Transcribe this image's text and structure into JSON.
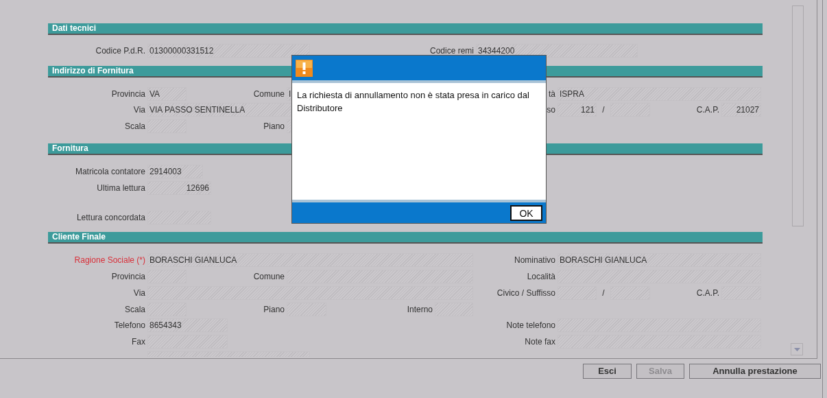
{
  "dati_tecnici": {
    "title": "Dati tecnici",
    "codice_pdr": {
      "label": "Codice P.d.R.",
      "value": "01300000331512"
    },
    "codice_remi": {
      "label": "Codice remi",
      "value": "34344200"
    }
  },
  "indirizzo_fornitura": {
    "title": "Indirizzo di Fornitura",
    "provincia": {
      "label": "Provincia",
      "value": "VA"
    },
    "comune": {
      "label": "Comune",
      "value": "I"
    },
    "localita": {
      "label": "tà",
      "value": "ISPRA"
    },
    "via": {
      "label": "Via",
      "value": "VIA PASSO SENTINELLA"
    },
    "civico": {
      "label": "so",
      "value": "121",
      "separator": "/"
    },
    "cap": {
      "label": "C.A.P.",
      "value": "21027"
    },
    "scala": {
      "label": "Scala"
    },
    "piano": {
      "label": "Piano"
    }
  },
  "fornitura": {
    "title": "Fornitura",
    "matricola": {
      "label": "Matricola contatore",
      "value": "2914003"
    },
    "ultima_lettura": {
      "label": "Ultima lettura",
      "value": "12696"
    },
    "lettura_concordata": {
      "label": "Lettura concordata"
    }
  },
  "cliente_finale": {
    "title": "Cliente Finale",
    "ragione_sociale": {
      "label": "Ragione Sociale (*)",
      "value": "BORASCHI GIANLUCA",
      "required": true
    },
    "nominativo": {
      "label": "Nominativo",
      "value": "BORASCHI GIANLUCA"
    },
    "provincia": {
      "label": "Provincia"
    },
    "comune": {
      "label": "Comune"
    },
    "localita": {
      "label": "Località"
    },
    "via": {
      "label": "Via"
    },
    "civico": {
      "label": "Civico / Suffisso",
      "separator": "/"
    },
    "cap": {
      "label": "C.A.P."
    },
    "scala": {
      "label": "Scala"
    },
    "piano": {
      "label": "Piano"
    },
    "interno": {
      "label": "Interno"
    },
    "telefono": {
      "label": "Telefono",
      "value": "8654343"
    },
    "note_telefono": {
      "label": "Note telefono"
    },
    "fax": {
      "label": "Fax"
    },
    "note_fax": {
      "label": "Note fax"
    }
  },
  "buttons": [
    {
      "label": "Esci",
      "disabled": false
    },
    {
      "label": "Salva",
      "disabled": true
    },
    {
      "label": "Annulla prestazione",
      "disabled": false
    }
  ],
  "dialog": {
    "message": "La richiesta di annullamento non è stata presa in carico dal Distributore",
    "ok_button": "OK"
  }
}
